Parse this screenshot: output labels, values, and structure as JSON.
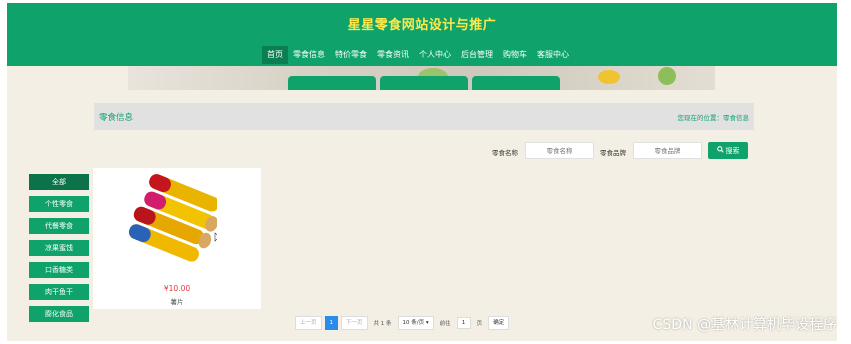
{
  "site": {
    "title": "星星零食网站设计与推广"
  },
  "nav": {
    "items": [
      {
        "label": "首页",
        "active": true
      },
      {
        "label": "零食信息",
        "active": false
      },
      {
        "label": "特价零食",
        "active": false
      },
      {
        "label": "零食资讯",
        "active": false
      },
      {
        "label": "个人中心",
        "active": false
      },
      {
        "label": "后台管理",
        "active": false
      },
      {
        "label": "购物车",
        "active": false
      },
      {
        "label": "客服中心",
        "active": false
      }
    ]
  },
  "breadcrumb": {
    "title": "零食信息",
    "location": "您现在的位置：零食信息"
  },
  "search": {
    "name_label": "零食名称",
    "name_placeholder": "零食名称",
    "brand_label": "零食品牌",
    "brand_placeholder": "零食品牌",
    "button_label": "搜索"
  },
  "categories": [
    {
      "label": "全部",
      "active": true
    },
    {
      "label": "个性零食",
      "active": false
    },
    {
      "label": "代餐零食",
      "active": false
    },
    {
      "label": "凉果蜜饯",
      "active": false
    },
    {
      "label": "口香糖类",
      "active": false
    },
    {
      "label": "肉干鱼干",
      "active": false
    },
    {
      "label": "膨化食品",
      "active": false
    }
  ],
  "products": [
    {
      "price": "¥10.00",
      "name": "薯片"
    }
  ],
  "pagination": {
    "prev": "上一页",
    "current": "1",
    "next": "下一页",
    "total": "共 1 条",
    "page_size": "10 条/页",
    "goto_label": "前往",
    "goto_value": "1",
    "page_unit": "页",
    "confirm": "确定"
  },
  "watermark": "CSDN @基林计算机毕设程序",
  "colors": {
    "brand_green": "#0fa36b",
    "title_yellow": "#ffe94a",
    "price_red": "#e4393c",
    "page_bg": "#f3efe4"
  }
}
